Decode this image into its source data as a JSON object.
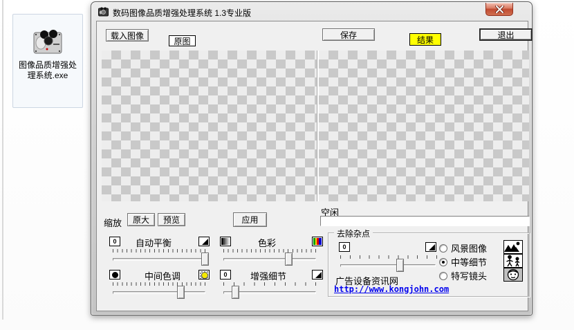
{
  "desktop_icon": {
    "label_line1": "图像品质增强处",
    "label_line2": "理系统.exe"
  },
  "window": {
    "title": "数码图像品质增强处理系统 1.3专业版"
  },
  "toolbar": {
    "load": "载入图像",
    "original": "原图",
    "save": "保存",
    "result": "结果",
    "exit": "退出"
  },
  "controls": {
    "zoom": "缩放",
    "original_size": "原大",
    "preview": "预览",
    "apply": "应用",
    "status": "空闲"
  },
  "sliders": {
    "auto_balance": {
      "label": "自动平衡",
      "value_pct": 96
    },
    "color": {
      "label": "色彩",
      "value_pct": 67
    },
    "midtone": {
      "label": "中间色调",
      "value_pct": 70
    },
    "detail": {
      "label": "增强细节",
      "value_pct": 8
    }
  },
  "denoise": {
    "title": "去除杂点",
    "slider_value_pct": 59,
    "radios": [
      {
        "label": "风景图像",
        "selected": false
      },
      {
        "label": "中等细节",
        "selected": true
      },
      {
        "label": "特写镜头",
        "selected": false
      }
    ],
    "site_name": "广告设备资讯网",
    "site_url": "http://www.kongjohn.com"
  },
  "colors": {
    "result_bg": "#ffff00",
    "link_blue": "#0000ee",
    "close_red": "#c04a31",
    "checker_dark": "#c9c9c9",
    "checker_light": "#ededed"
  }
}
